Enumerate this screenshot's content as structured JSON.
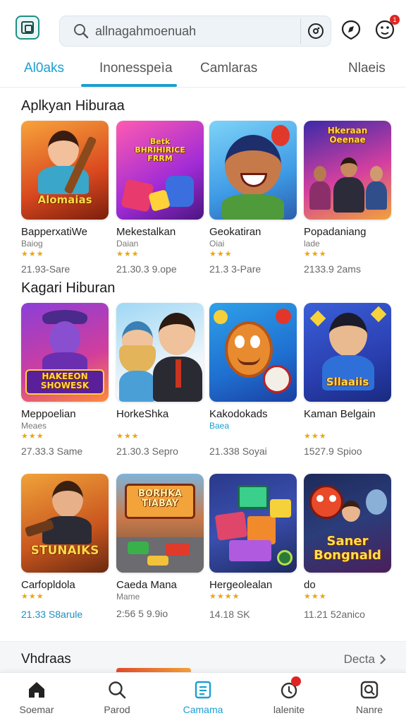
{
  "header": {
    "search_placeholder": "allnagahmoenuah",
    "icons": [
      "app-logo-icon",
      "search-icon",
      "lens-icon",
      "compass-icon",
      "notifications-icon"
    ],
    "notification_badge": "1"
  },
  "tabs": [
    {
      "label": "Al0aks",
      "active": false,
      "color": "#1a9fd0"
    },
    {
      "label": "Inonesspeìa",
      "active": true
    },
    {
      "label": "Camlaras",
      "active": false
    },
    {
      "label": "Nlaeis",
      "active": false
    }
  ],
  "sections": [
    {
      "title": "Aplkyan Hiburaa",
      "apps": [
        {
          "name": "BapperxatiWe",
          "sub": "Baiog",
          "stars": "★★★",
          "meta": "21.93-Sare"
        },
        {
          "name": "Mekestalkan",
          "sub": "Daian",
          "stars": "★★★",
          "meta": "21.30.3 9.ope"
        },
        {
          "name": "Geokatiran",
          "sub": "Oiai",
          "stars": "★★★",
          "meta": "21.3 3-Pare"
        },
        {
          "name": "Popadaniang",
          "sub": "lade",
          "stars": "★★★",
          "meta": "2133.9 2ams"
        }
      ]
    },
    {
      "title": "Kagari Hiburan",
      "apps": [
        {
          "name": "Meppoelian",
          "sub": "Meaes",
          "stars": "★★★",
          "meta": "27.33.3 Same"
        },
        {
          "name": "HorkeShka",
          "sub": "",
          "stars": "★★★",
          "meta": "21.30.3 Sepro"
        },
        {
          "name": "Kakodokads",
          "sub": "Baea",
          "stars": "",
          "meta": "21.338 Soyai"
        },
        {
          "name": "Kaman Belgain",
          "sub": "",
          "stars": "★★★",
          "meta": "1527.9 Spioo"
        }
      ]
    },
    {
      "title": "",
      "apps": [
        {
          "name": "Carfopldola",
          "sub": "",
          "stars": "★★★",
          "meta": "21.33 S8arule"
        },
        {
          "name": "Caeda Mana",
          "sub": "Mame",
          "stars": "",
          "meta": "2:56 5 9.9io"
        },
        {
          "name": "Hergeolealan",
          "sub": "",
          "stars": "★★★★",
          "meta": "14.18 SK"
        },
        {
          "name": "do",
          "sub": "",
          "stars": "★★★",
          "meta": "11.21 52anico"
        }
      ]
    }
  ],
  "thumb_texts": {
    "t1": "Alomaias",
    "t2": "Betk\nBHRIHIRICE\nFRRM",
    "t5": "HAKEEON\nSHOWESK",
    "t9": "STUNAIKS",
    "t10": "BORHKA\nTIABAY",
    "t12": "Saner\nBongnald",
    "t8": "Sllaaiis",
    "t4": "Hkeraan\nOeenae"
  },
  "more": {
    "title": "Vhdraas",
    "link": "Decta"
  },
  "bottom_nav": [
    {
      "label": "Soemar",
      "icon": "home-icon"
    },
    {
      "label": "Parod",
      "icon": "search-icon"
    },
    {
      "label": "Camama",
      "icon": "apps-icon",
      "active": true
    },
    {
      "label": "lalenite",
      "icon": "updates-icon",
      "badge": true
    },
    {
      "label": "Nanre",
      "icon": "library-icon"
    }
  ],
  "colors": {
    "accent": "#1a9fd0",
    "star": "#e9a714",
    "badge": "#e02424"
  }
}
